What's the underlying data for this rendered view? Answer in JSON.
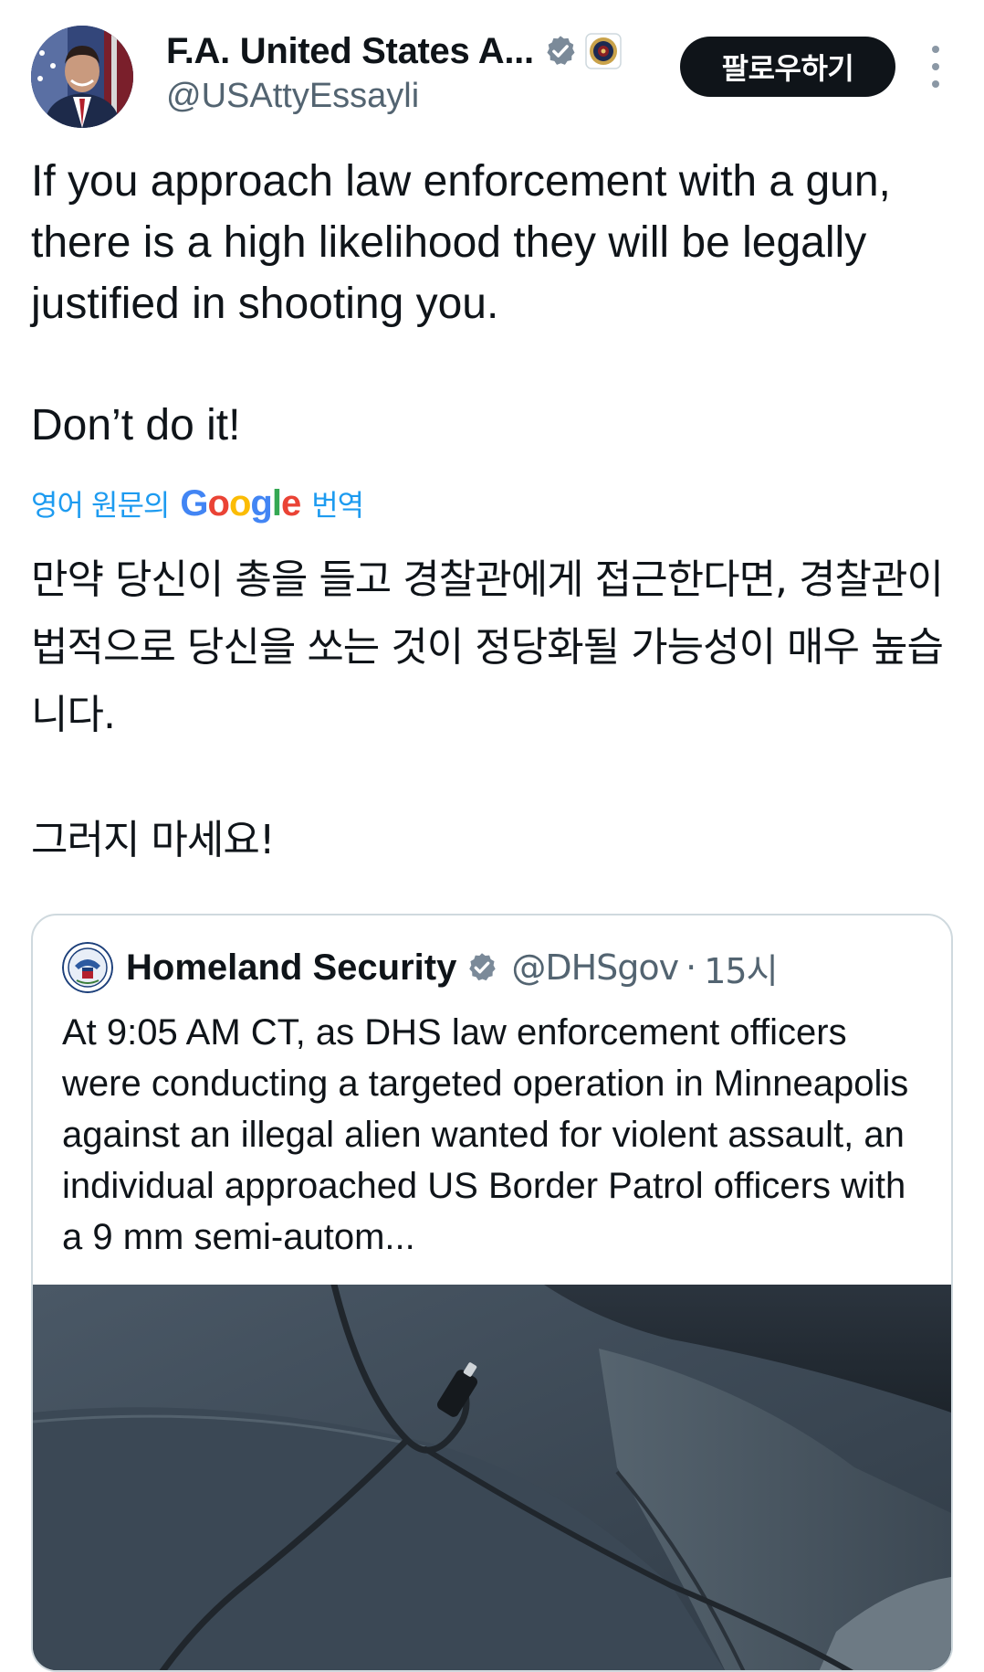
{
  "author": {
    "display_name": "F.A. United States A...",
    "handle": "@USAttyEssayli",
    "avatar_icon": "person-avatar",
    "verified_icon": "verified-badge-icon",
    "affiliation_icon": "doj-seal-icon"
  },
  "actions": {
    "follow_label": "팔로우하기",
    "more_icon": "more-vertical-icon"
  },
  "tweet": {
    "paragraph_1": "If you approach law enforcement with a gun, there is a high likelihood they will be legally justified in shooting you.",
    "paragraph_2": "Don’t do it!"
  },
  "translation": {
    "prefix": "영어 원문의",
    "provider": "Google",
    "suffix": "번역",
    "paragraph_1": "만약 당신이 총을 들고 경찰관에게 접근한다면, 경찰관이 법적으로 당신을 쏘는 것이 정당화될 가능성이 매우 높습니다.",
    "paragraph_2": "그러지 마세요!"
  },
  "quoted_tweet": {
    "name": "Homeland Security",
    "handle": "@DHSgov",
    "separator": "·",
    "time": "15시",
    "avatar_icon": "dhs-seal-icon",
    "verified_icon": "verified-badge-icon",
    "text": "At 9:05 AM CT, as DHS law enforcement officers were conducting a targeted operation in Minneapolis against an illegal alien wanted for violent assault, an individual approached US Border Patrol officers with a 9 mm semi-autom...",
    "media_icon": "photo-car-seat-with-cable"
  },
  "colors": {
    "text_primary": "#0f1419",
    "text_secondary": "#536471",
    "link_blue": "#1d9bf0",
    "verified_blue": "#7b8a99",
    "border": "#cfd9de",
    "follow_bg": "#0f1419"
  }
}
